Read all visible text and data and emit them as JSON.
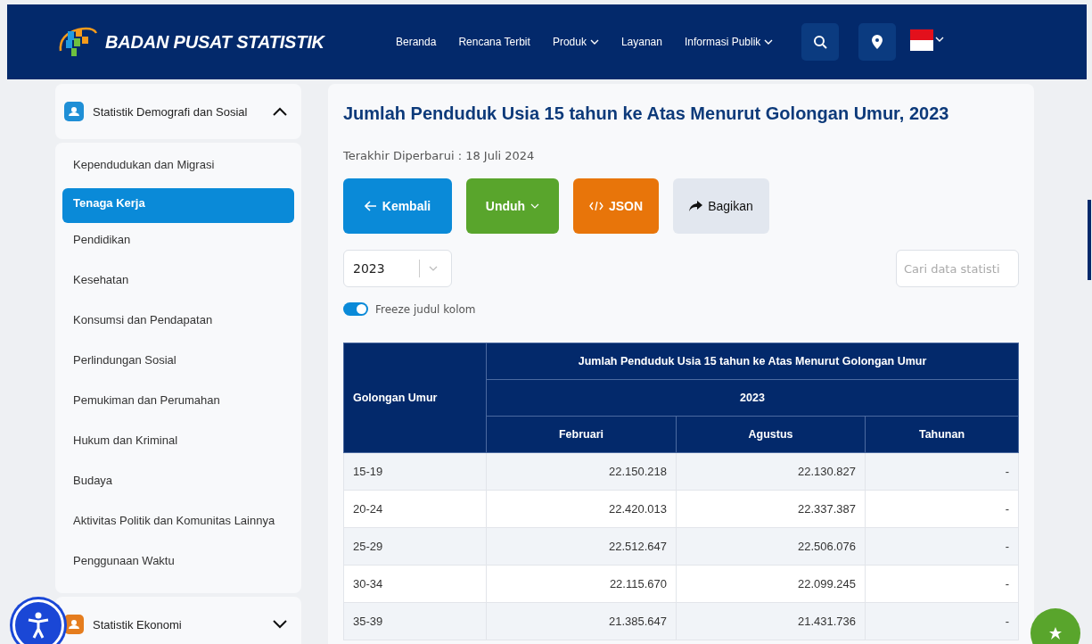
{
  "header": {
    "brand": "BADAN PUSAT STATISTIK",
    "nav": [
      {
        "label": "Beranda",
        "dropdown": false
      },
      {
        "label": "Rencana Terbit",
        "dropdown": false
      },
      {
        "label": "Produk",
        "dropdown": true
      },
      {
        "label": "Layanan",
        "dropdown": false
      },
      {
        "label": "Informasi Publik",
        "dropdown": true
      }
    ]
  },
  "sidebar": {
    "groups": [
      {
        "title": "Statistik Demografi dan Sosial",
        "expanded": true,
        "color": "#1f8fd6",
        "items": [
          {
            "label": "Kependudukan dan Migrasi",
            "selected": false
          },
          {
            "label": "Tenaga Kerja",
            "selected": true
          },
          {
            "label": "Pendidikan",
            "selected": false
          },
          {
            "label": "Kesehatan",
            "selected": false
          },
          {
            "label": "Konsumsi dan Pendapatan",
            "selected": false
          },
          {
            "label": "Perlindungan Sosial",
            "selected": false
          },
          {
            "label": "Pemukiman dan Perumahan",
            "selected": false
          },
          {
            "label": "Hukum dan Kriminal",
            "selected": false
          },
          {
            "label": "Budaya",
            "selected": false
          },
          {
            "label": "Aktivitas Politik dan Komunitas Lainnya",
            "selected": false
          },
          {
            "label": "Penggunaan Waktu",
            "selected": false
          }
        ]
      },
      {
        "title": "Statistik Ekonomi",
        "expanded": false,
        "color": "#e57d1e"
      }
    ]
  },
  "main": {
    "title": "Jumlah Penduduk Usia 15 tahun ke Atas Menurut Golongan Umur, 2023",
    "updated": "Terakhir Diperbarui : 18 Juli 2024",
    "buttons": [
      {
        "label": "Kembali",
        "kind": "back"
      },
      {
        "label": "Unduh",
        "kind": "download"
      },
      {
        "label": "JSON",
        "kind": "json"
      },
      {
        "label": "Bagikan",
        "kind": "share"
      }
    ],
    "year_select": {
      "value": "2023"
    },
    "search": {
      "placeholder": "Cari data statisti"
    },
    "freeze_toggle": {
      "label": "Freeze judul kolom",
      "on": true
    },
    "table": {
      "group_header": "Jumlah Penduduk Usia 15 tahun ke Atas Menurut Golongan Umur",
      "year": "2023",
      "columns": [
        "Golongan Umur",
        "Februari",
        "Agustus",
        "Tahunan"
      ],
      "rows": [
        {
          "cells": [
            "15-19",
            "22.150.218",
            "22.130.827",
            "-"
          ]
        },
        {
          "cells": [
            "20-24",
            "22.420.013",
            "22.337.387",
            "-"
          ]
        },
        {
          "cells": [
            "25-29",
            "22.512.647",
            "22.506.076",
            "-"
          ]
        },
        {
          "cells": [
            "30-34",
            "22.115.670",
            "22.099.245",
            "-"
          ]
        },
        {
          "cells": [
            "35-39",
            "21.385.647",
            "21.431.736",
            "-"
          ]
        }
      ]
    }
  }
}
